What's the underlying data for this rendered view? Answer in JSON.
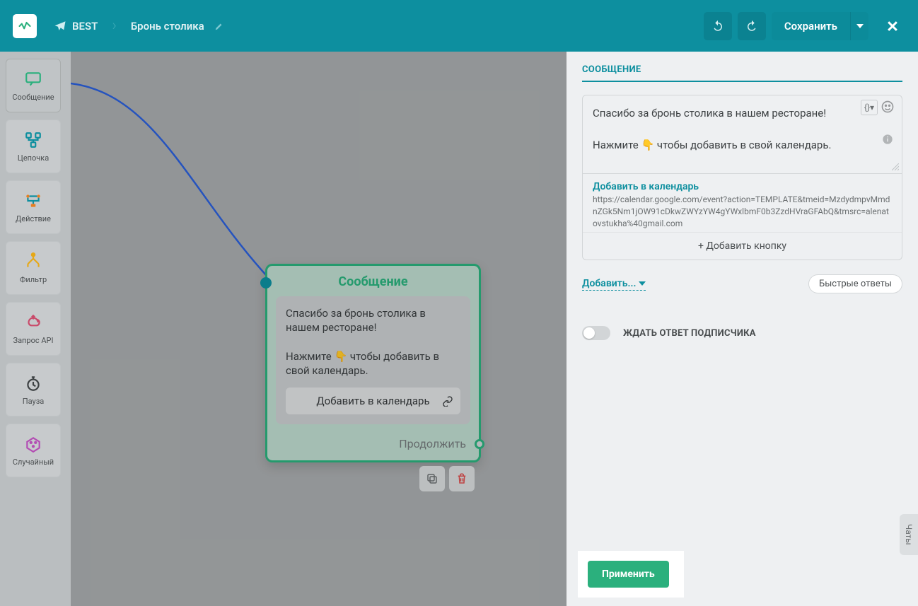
{
  "header": {
    "bot_name": "BEST",
    "flow_name": "Бронь столика",
    "save_label": "Сохранить"
  },
  "toolbox": {
    "items": [
      {
        "label": "Сообщение"
      },
      {
        "label": "Цепочка"
      },
      {
        "label": "Действие"
      },
      {
        "label": "Фильтр"
      },
      {
        "label": "Запрос API"
      },
      {
        "label": "Пауза"
      },
      {
        "label": "Случайный"
      }
    ]
  },
  "node": {
    "title": "Сообщение",
    "text": "Спасибо за бронь столика в нашем ресторане!\n\nНажмите 👇 чтобы добавить в свой календарь.",
    "button_label": "Добавить в календарь",
    "continue_label": "Продолжить"
  },
  "sidepanel": {
    "title": "СООБЩЕНИЕ",
    "message_text": "Спасибо за бронь столика в нашем ресторане!\n\nНажмите 👇 чтобы добавить в свой календарь.",
    "button": {
      "label": "Добавить в календарь",
      "url": "https://calendar.google.com/event?action=TEMPLATE&tmeid=MzdydmpvMmdnZGk5Nm1jOW91cDkwZWYzYW4gYWxlbmF0b3ZzdHVraGFAbQ&tmsrc=alenatovstukha%40gmail.com"
    },
    "add_button_label": "+ Добавить кнопку",
    "add_more_label": "Добавить...",
    "quick_replies_label": "Быстрые ответы",
    "wait_label": "ЖДАТЬ ОТВЕТ ПОДПИСЧИКА",
    "apply_label": "Применить"
  },
  "chats_tab": "Чаты"
}
